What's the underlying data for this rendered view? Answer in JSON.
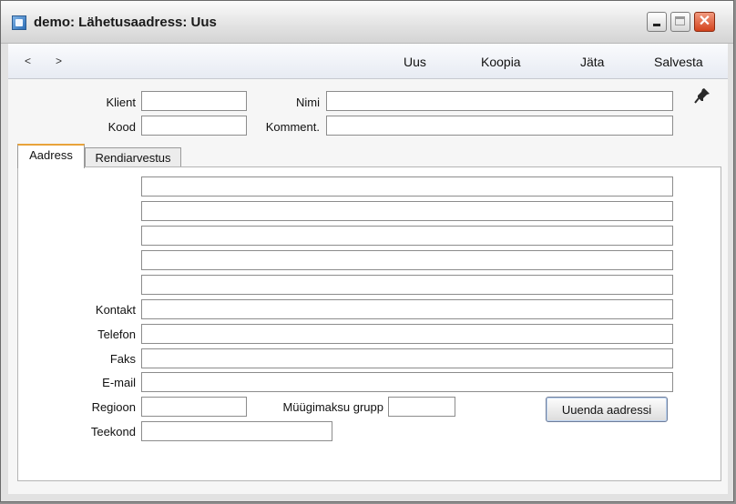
{
  "window": {
    "title": "demo: Lähetusaadress: Uus"
  },
  "nav": {
    "back": "<",
    "forward": ">"
  },
  "menu": {
    "new": "Uus",
    "copy": "Koopia",
    "leave": "Jäta",
    "save": "Salvesta"
  },
  "header": {
    "client_label": "Klient",
    "client_value": "",
    "name_label": "Nimi",
    "name_value": "",
    "code_label": "Kood",
    "code_value": "",
    "comment_label": "Komment.",
    "comment_value": ""
  },
  "tabs": [
    {
      "label": "Aadress"
    },
    {
      "label": "Rendiarvestus"
    }
  ],
  "address": {
    "lines": [
      "",
      "",
      "",
      "",
      ""
    ],
    "contact_label": "Kontakt",
    "contact_value": "",
    "phone_label": "Telefon",
    "phone_value": "",
    "fax_label": "Faks",
    "fax_value": "",
    "email_label": "E-mail",
    "email_value": "",
    "region_label": "Regioon",
    "region_value": "",
    "sales_tax_group_label": "Müügimaksu grupp",
    "sales_tax_group_value": "",
    "route_label": "Teekond",
    "route_value": "",
    "update_button": "Uuenda aadressi"
  }
}
